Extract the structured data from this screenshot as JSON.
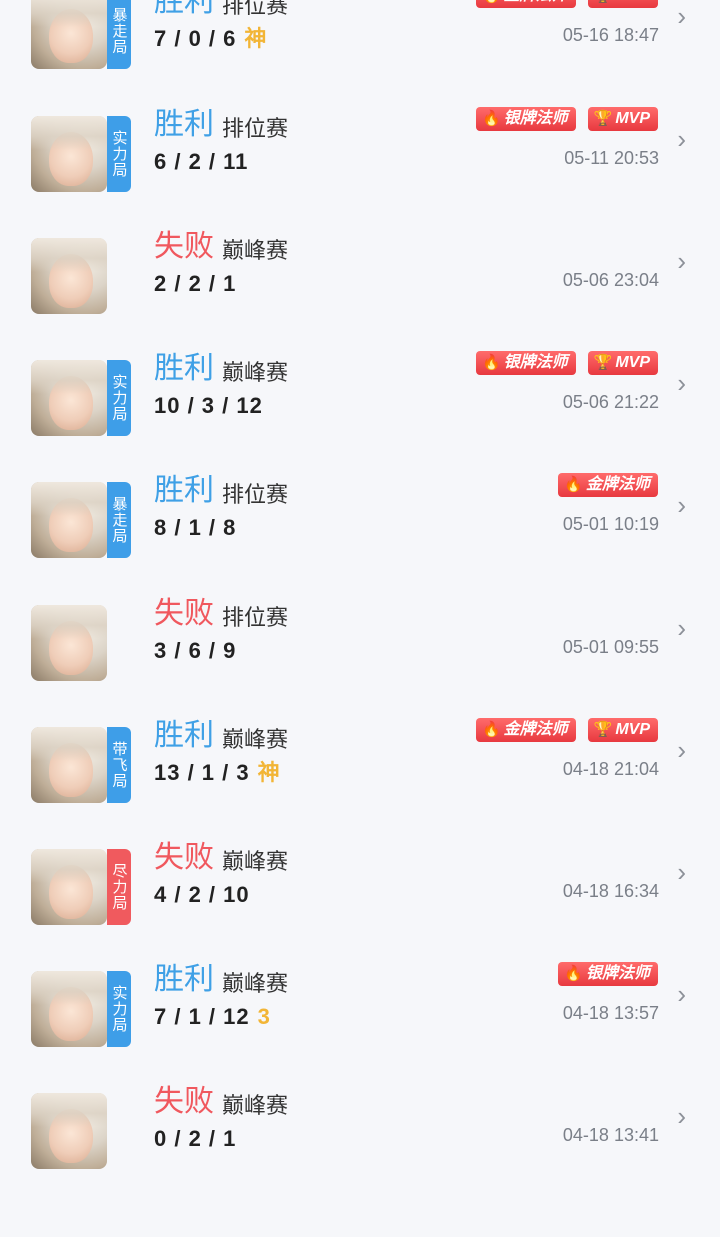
{
  "matches": [
    {
      "avatar": "hero-portrait",
      "tag": "暴走局",
      "tag_color": "#3e9ee8",
      "result": "胜利",
      "result_type": "win",
      "mode": "排位赛",
      "kda": "7 / 0 / 6",
      "extra": "神",
      "badges": [
        "金牌法师",
        "MVP"
      ],
      "time": "05-16 18:47"
    },
    {
      "avatar": "hero-portrait",
      "tag": "实力局",
      "tag_color": "#3e9ee8",
      "result": "胜利",
      "result_type": "win",
      "mode": "排位赛",
      "kda": "6 / 2 / 11",
      "extra": "",
      "badges": [
        "银牌法师",
        "MVP"
      ],
      "time": "05-11 20:53"
    },
    {
      "avatar": "hero-portrait",
      "tag": "",
      "tag_color": "",
      "result": "失败",
      "result_type": "lose",
      "mode": "巅峰赛",
      "kda": "2 / 2 / 1",
      "extra": "",
      "badges": [],
      "time": "05-06 23:04"
    },
    {
      "avatar": "hero-portrait",
      "tag": "实力局",
      "tag_color": "#3e9ee8",
      "result": "胜利",
      "result_type": "win",
      "mode": "巅峰赛",
      "kda": "10 / 3 / 12",
      "extra": "",
      "badges": [
        "银牌法师",
        "MVP"
      ],
      "time": "05-06 21:22"
    },
    {
      "avatar": "hero-portrait",
      "tag": "暴走局",
      "tag_color": "#3e9ee8",
      "result": "胜利",
      "result_type": "win",
      "mode": "排位赛",
      "kda": "8 / 1 / 8",
      "extra": "",
      "badges": [
        "金牌法师"
      ],
      "time": "05-01 10:19"
    },
    {
      "avatar": "hero-portrait",
      "tag": "",
      "tag_color": "",
      "result": "失败",
      "result_type": "lose",
      "mode": "排位赛",
      "kda": "3 / 6 / 9",
      "extra": "",
      "badges": [],
      "time": "05-01 09:55"
    },
    {
      "avatar": "hero-portrait",
      "tag": "带飞局",
      "tag_color": "#3e9ee8",
      "result": "胜利",
      "result_type": "win",
      "mode": "巅峰赛",
      "kda": "13 / 1 / 3",
      "extra": "神",
      "badges": [
        "金牌法师",
        "MVP"
      ],
      "time": "04-18 21:04"
    },
    {
      "avatar": "hero-portrait",
      "tag": "尽力局",
      "tag_color": "#f05a5e",
      "result": "失败",
      "result_type": "lose",
      "mode": "巅峰赛",
      "kda": "4 / 2 / 10",
      "extra": "",
      "badges": [],
      "time": "04-18 16:34"
    },
    {
      "avatar": "hero-portrait",
      "tag": "实力局",
      "tag_color": "#3e9ee8",
      "result": "胜利",
      "result_type": "win",
      "mode": "巅峰赛",
      "kda": "7 / 1 / 12",
      "extra": "3",
      "badges": [
        "银牌法师"
      ],
      "time": "04-18 13:57"
    },
    {
      "avatar": "hero-portrait",
      "tag": "",
      "tag_color": "",
      "result": "失败",
      "result_type": "lose",
      "mode": "巅峰赛",
      "kda": "0 / 2 / 1",
      "extra": "",
      "badges": [],
      "time": "04-18 13:41"
    }
  ]
}
